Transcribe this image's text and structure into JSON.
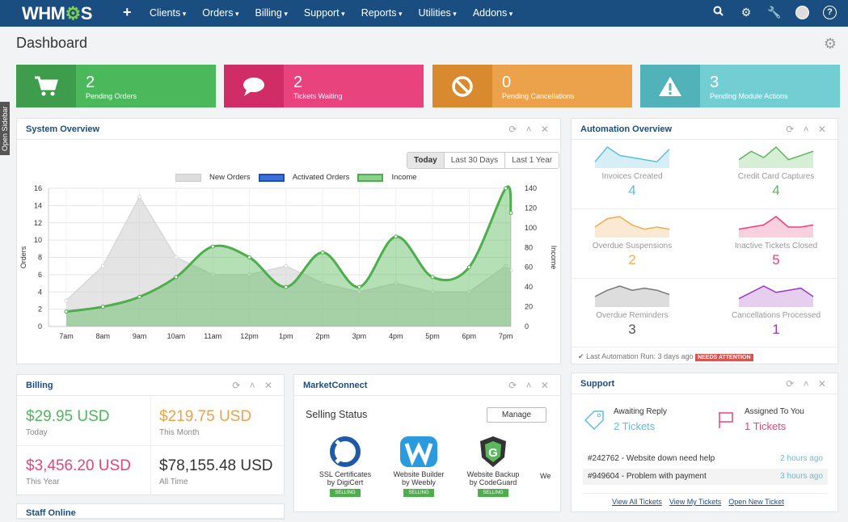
{
  "nav": {
    "logo": "WHMCS",
    "plus": "+",
    "items": [
      "Clients",
      "Orders",
      "Billing",
      "Support",
      "Reports",
      "Utilities",
      "Addons"
    ]
  },
  "sidebar_tab": "Open Sidebar",
  "page": {
    "title": "Dashboard"
  },
  "stats": [
    {
      "value": "2",
      "label": "Pending Orders",
      "color": "#4cb85c",
      "icon": "cart-icon"
    },
    {
      "value": "2",
      "label": "Tickets Waiting",
      "color": "#e8437c",
      "icon": "chat-bubble-icon"
    },
    {
      "value": "0",
      "label": "Pending Cancellations",
      "color": "#eca24b",
      "icon": "ban-icon"
    },
    {
      "value": "3",
      "label": "Pending Module Actions",
      "color": "#73ced4",
      "icon": "warning-icon"
    }
  ],
  "system_overview": {
    "title": "System Overview",
    "ranges": [
      "Today",
      "Last 30 Days",
      "Last 1 Year"
    ],
    "legend": [
      "New Orders",
      "Activated Orders",
      "Income"
    ]
  },
  "chart_data": {
    "type": "area",
    "categories": [
      "7am",
      "8am",
      "9am",
      "10am",
      "11am",
      "12pm",
      "1pm",
      "2pm",
      "3pm",
      "4pm",
      "5pm",
      "6pm",
      "7pm"
    ],
    "ylabel": "Orders",
    "y2label": "Income",
    "ylim": [
      0,
      16
    ],
    "y2lim": [
      0,
      140
    ],
    "yticks": [
      0,
      2,
      4,
      6,
      8,
      10,
      12,
      14,
      16
    ],
    "y2ticks": [
      0,
      20,
      40,
      60,
      80,
      100,
      120,
      140
    ],
    "series": [
      {
        "name": "New Orders",
        "axis": "left",
        "color": "#cccccc",
        "values": [
          3,
          7,
          15,
          8,
          6,
          6,
          7,
          5,
          4,
          5,
          4,
          4,
          7,
          6.5
        ]
      },
      {
        "name": "Income",
        "axis": "right",
        "color": "#5cb85c",
        "values": [
          15,
          20,
          30,
          50,
          81,
          70,
          40,
          75,
          40,
          91,
          50,
          60,
          140,
          115
        ]
      }
    ]
  },
  "automation": {
    "title": "Automation Overview",
    "items": [
      {
        "label": "Invoices Created",
        "value": "4",
        "color": "#5bc0de"
      },
      {
        "label": "Credit Card Captures",
        "value": "4",
        "color": "#5cb85c"
      },
      {
        "label": "Overdue Suspensions",
        "value": "2",
        "color": "#f0ad4e"
      },
      {
        "label": "Inactive Tickets Closed",
        "value": "5",
        "color": "#e8437c"
      },
      {
        "label": "Overdue Reminders",
        "value": "3",
        "color": "#777777"
      },
      {
        "label": "Cancellations Processed",
        "value": "1",
        "color": "#9b3bc0"
      }
    ],
    "last_run": "Last Automation Run: 3 days ago",
    "badge": "NEEDS ATTENTION"
  },
  "billing": {
    "title": "Billing",
    "cells": [
      {
        "amount": "$29.95 USD",
        "label": "Today",
        "color": "#4cb85c"
      },
      {
        "amount": "$219.75 USD",
        "label": "This Month",
        "color": "#eca24b"
      },
      {
        "amount": "$3,456.20 USD",
        "label": "This Year",
        "color": "#e8437c"
      },
      {
        "amount": "$78,155.48 USD",
        "label": "All Time",
        "color": "#333333"
      }
    ]
  },
  "marketconnect": {
    "title": "MarketConnect",
    "status_label": "Selling Status",
    "manage": "Manage",
    "products": [
      {
        "name": "SSL Certificates",
        "vendor": "by DigiCert",
        "badge": "SELLING"
      },
      {
        "name": "Website Builder",
        "vendor": "by Weebly",
        "badge": "SELLING"
      },
      {
        "name": "Website Backup",
        "vendor": "by CodeGuard",
        "badge": "SELLING"
      },
      {
        "name": "We",
        "vendor": "",
        "badge": ""
      }
    ]
  },
  "support": {
    "title": "Support",
    "awaiting_label": "Awaiting Reply",
    "awaiting_value": "2 Tickets",
    "assigned_label": "Assigned To You",
    "assigned_value": "1 Tickets",
    "tickets": [
      {
        "subject": "#242762 - Website down need help",
        "time": "2 hours ago"
      },
      {
        "subject": "#949604 - Problem with payment",
        "time": "3 hours ago"
      }
    ],
    "links": [
      "View All Tickets",
      "View My Tickets",
      "Open New Ticket"
    ]
  },
  "staff": {
    "title": "Staff Online"
  }
}
